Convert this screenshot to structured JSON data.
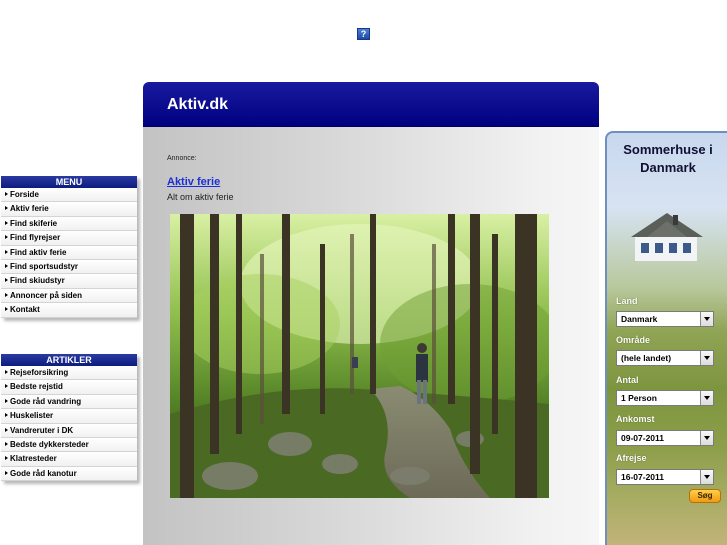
{
  "help_icon_symbol": "?",
  "menu": {
    "title": "MENU",
    "items": [
      "Forside",
      "Aktiv ferie",
      "Find skiferie",
      "Find flyrejser",
      "Find aktiv ferie",
      "Find sportsudstyr",
      "Find skiudstyr",
      "Annoncer på siden",
      "Kontakt"
    ]
  },
  "artikler": {
    "title": "ARTIKLER",
    "items": [
      "Rejseforsikring",
      "Bedste rejstid",
      "Gode råd vandring",
      "Huskelister",
      "Vandreruter i DK",
      "Bedste dykkersteder",
      "Klatresteder",
      "Gode råd kanotur"
    ]
  },
  "main": {
    "title": "Aktiv.dk",
    "annonce_label": "Annonce:",
    "ad_link": "Aktiv ferie",
    "ad_description": "Alt om aktiv ferie",
    "photo_icon": "forest-hiking-photo"
  },
  "sommerhuse": {
    "title_line1": "Sommerhuse i",
    "title_line2": "Danmark",
    "land_label": "Land",
    "land_value": "Danmark",
    "omraade_label": "Område",
    "omraade_value": "(hele landet)",
    "antal_label": "Antal",
    "antal_value": "1 Person",
    "ankomst_label": "Ankomst",
    "ankomst_value": "09-07-2011",
    "afrejse_label": "Afrejse",
    "afrejse_value": "16-07-2011",
    "search_label": "Søg"
  },
  "colors": {
    "header_navy": "#000080",
    "link_blue": "#1a2fd6",
    "search_orange": "#f29a12"
  }
}
